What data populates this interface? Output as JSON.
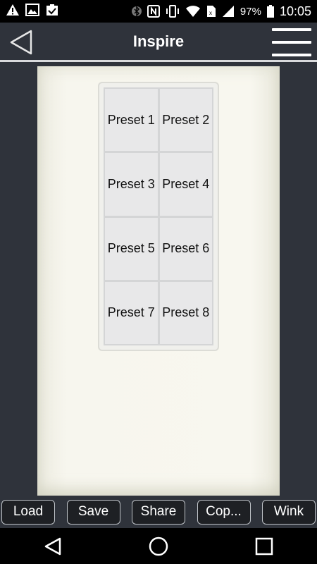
{
  "status_bar": {
    "battery_percent": "97%",
    "time": "10:05",
    "left_icons": [
      "warning-icon",
      "image-icon",
      "clipboard-check-icon"
    ],
    "right_icons": [
      "bluetooth-icon",
      "nfc-icon",
      "vibrate-icon",
      "wifi-icon",
      "sim-icon",
      "signal-icon",
      "battery-icon"
    ]
  },
  "app_bar": {
    "title": "Inspire"
  },
  "keypad": {
    "presets": [
      {
        "label": "Preset 1"
      },
      {
        "label": "Preset 2"
      },
      {
        "label": "Preset 3"
      },
      {
        "label": "Preset 4"
      },
      {
        "label": "Preset 5"
      },
      {
        "label": "Preset 6"
      },
      {
        "label": "Preset 7"
      },
      {
        "label": "Preset 8"
      }
    ]
  },
  "toolbar": {
    "load_label": "Load",
    "save_label": "Save",
    "share_label": "Share",
    "copy_label": "Cop...",
    "wink_label": "Wink"
  },
  "colors": {
    "background": "#2f333b",
    "plate": "#f7f6ee",
    "button_fill": "#e8e8e9",
    "toolbar_button": "#1e2024"
  }
}
